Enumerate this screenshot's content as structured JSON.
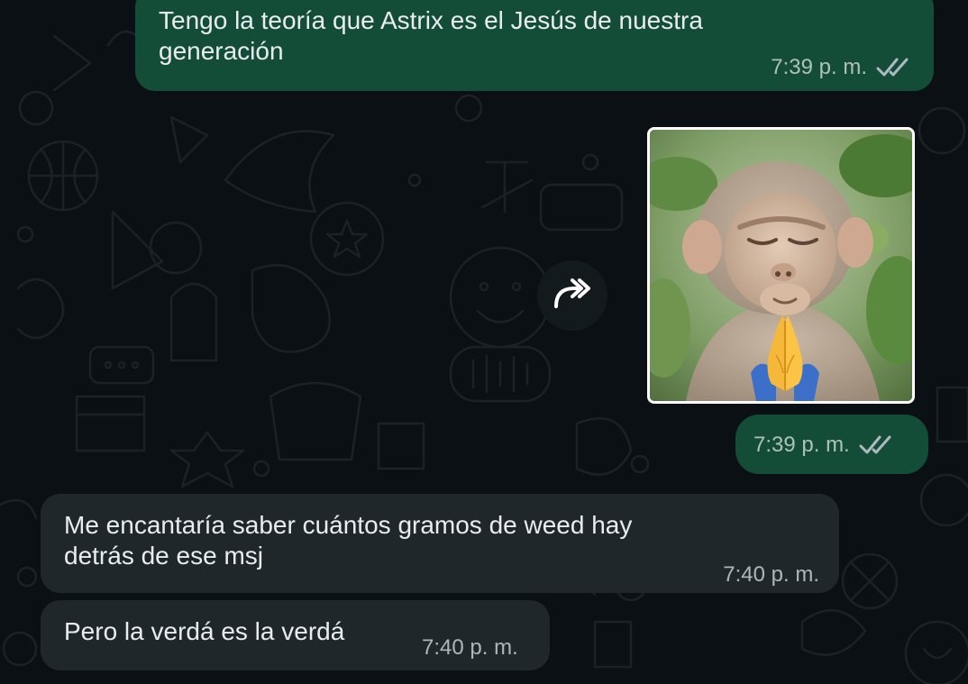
{
  "chat": {
    "messages": [
      {
        "direction": "outgoing",
        "text": "Tengo la teoría que Astrix es el Jesús de nuestra\ngeneración",
        "time": "7:39 p. m.",
        "status_icon": "double-check-icon"
      },
      {
        "direction": "outgoing",
        "type": "sticker",
        "sticker_subject": "monkey with praying hands emoji",
        "time": "7:39 p. m.",
        "status_icon": "double-check-icon"
      },
      {
        "direction": "incoming",
        "text": "Me encantaría saber cuántos gramos de weed hay\ndetrás de ese msj",
        "time": "7:40 p. m."
      },
      {
        "direction": "incoming",
        "text": "Pero la verdá es la verdá",
        "time": "7:40 p. m."
      }
    ],
    "forward_icon": "forward-arrow-icon"
  },
  "colors": {
    "background": "#0b1014",
    "outgoing_bubble": "#144d37",
    "incoming_bubble": "#1f272a",
    "text": "#e9edef",
    "meta_text": "#aebac1"
  }
}
